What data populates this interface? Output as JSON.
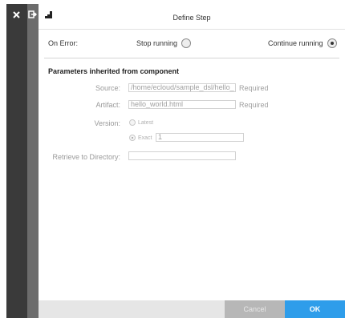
{
  "window": {
    "title": "Define Step"
  },
  "on_error": {
    "label": "On Error:",
    "options": [
      {
        "label": "Stop running",
        "selected": false
      },
      {
        "label": "Continue running",
        "selected": true
      }
    ]
  },
  "section": {
    "title": "Parameters inherited from component"
  },
  "fields": {
    "source": {
      "label": "Source:",
      "value": "/home/ecloud/sample_dsl/hello_",
      "required": "Required"
    },
    "artifact": {
      "label": "Artifact:",
      "value": "hello_world.html",
      "required": "Required"
    },
    "version": {
      "label": "Version:",
      "latest_label": "Latest",
      "exact_label": "Exact",
      "exact_value": "1",
      "selected": "exact"
    },
    "retrieve": {
      "label": "Retrieve to Directory:",
      "value": ""
    }
  },
  "footer": {
    "cancel_label": "Cancel",
    "ok_label": "OK"
  },
  "icons": {
    "close": "close-icon",
    "exit": "exit-icon",
    "logo": "step-logo-icon"
  },
  "colors": {
    "ok_button": "#2e9dea",
    "cancel_button": "#b7b7b7",
    "rail_dark": "#3a3a3a",
    "rail_mid": "#6c6c6c"
  }
}
